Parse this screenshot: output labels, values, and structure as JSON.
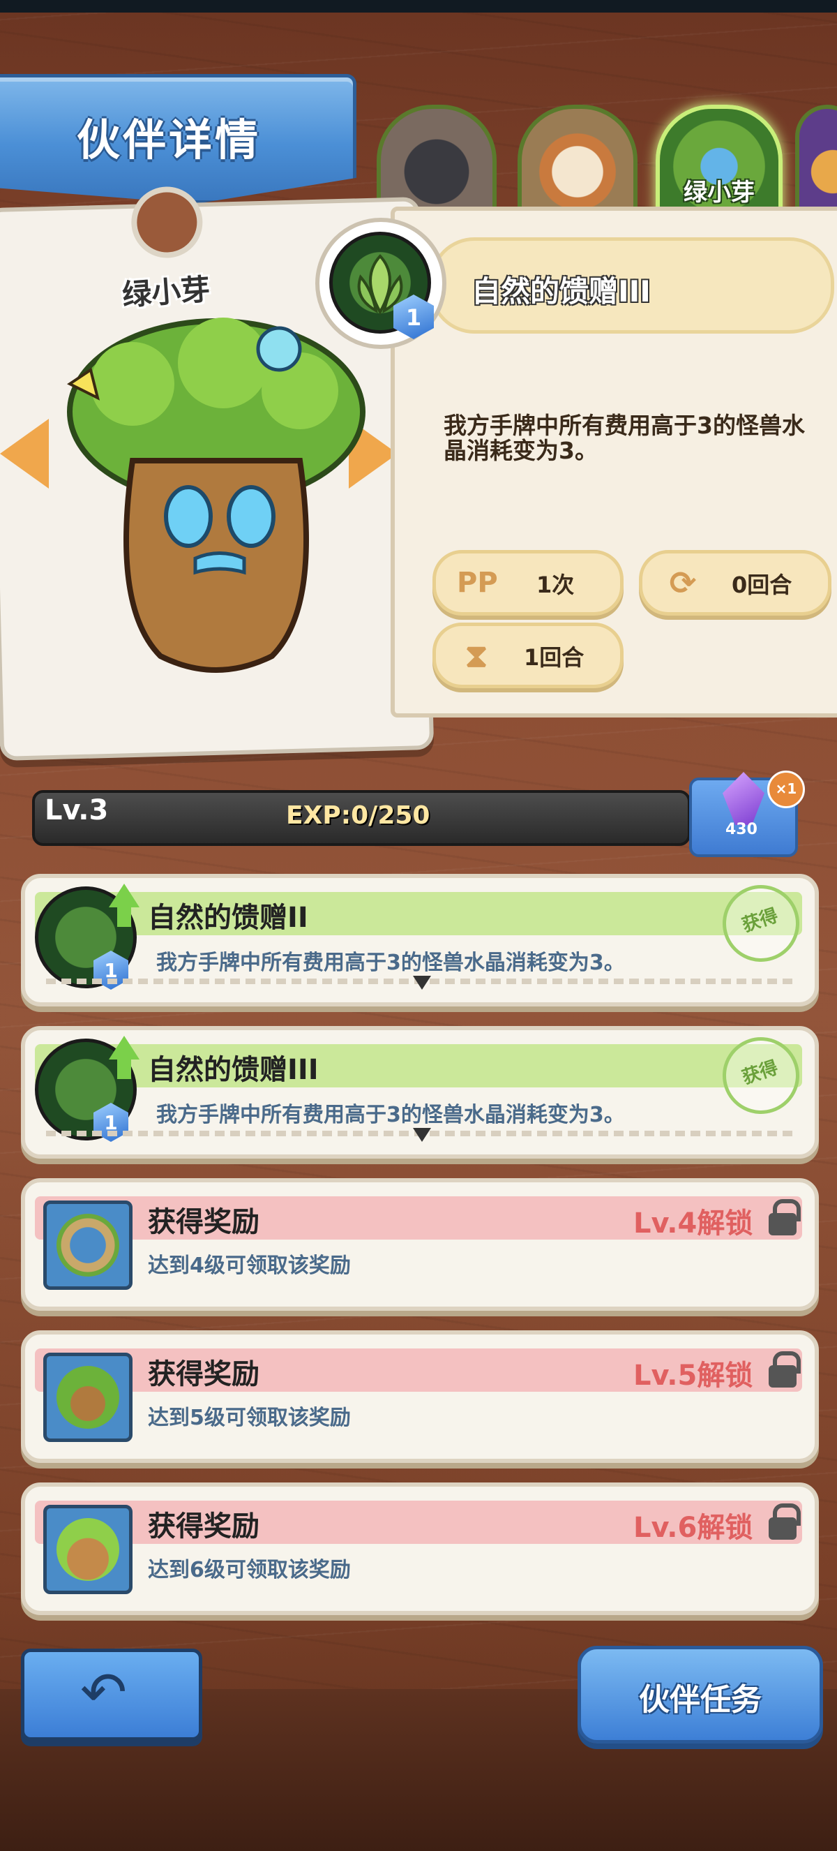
{
  "header": {
    "title": "伙伴详情"
  },
  "portraits": {
    "selected_name": "绿小芽"
  },
  "character": {
    "name": "绿小芽"
  },
  "skill": {
    "name": "自然的馈赠III",
    "gem_level": "1",
    "description": "我方手牌中所有费用高于3的怪兽水晶消耗变为3。",
    "pp_icon": "PP",
    "pp_value": "1次",
    "cooldown_value": "0回合",
    "duration_value": "1回合"
  },
  "level": {
    "label": "Lv.3",
    "exp": "EXP:0/250"
  },
  "crystal": {
    "count": "430",
    "multiplier": "×1",
    "color": "#7a3bd0"
  },
  "rows": [
    {
      "title": "自然的馈赠II",
      "desc": "我方手牌中所有费用高于3的怪兽水晶消耗变为3。",
      "gem": "1",
      "stamp": "获得"
    },
    {
      "title": "自然的馈赠III",
      "desc": "我方手牌中所有费用高于3的怪兽水晶消耗变为3。",
      "gem": "1",
      "stamp": "获得"
    },
    {
      "title": "获得奖励",
      "desc": "达到4级可领取该奖励",
      "unlock": "Lv.4解锁"
    },
    {
      "title": "获得奖励",
      "desc": "达到5级可领取该奖励",
      "unlock": "Lv.5解锁"
    },
    {
      "title": "获得奖励",
      "desc": "达到6级可领取该奖励",
      "unlock": "Lv.6解锁"
    }
  ],
  "buttons": {
    "task": "伙伴任务",
    "back_icon": "back-arrow-icon"
  },
  "colors": {
    "accent_blue": "#3c7ed6",
    "skill_green": "#cbe89a",
    "reward_pink": "#f4c1c1",
    "unlock_red": "#e06060"
  }
}
